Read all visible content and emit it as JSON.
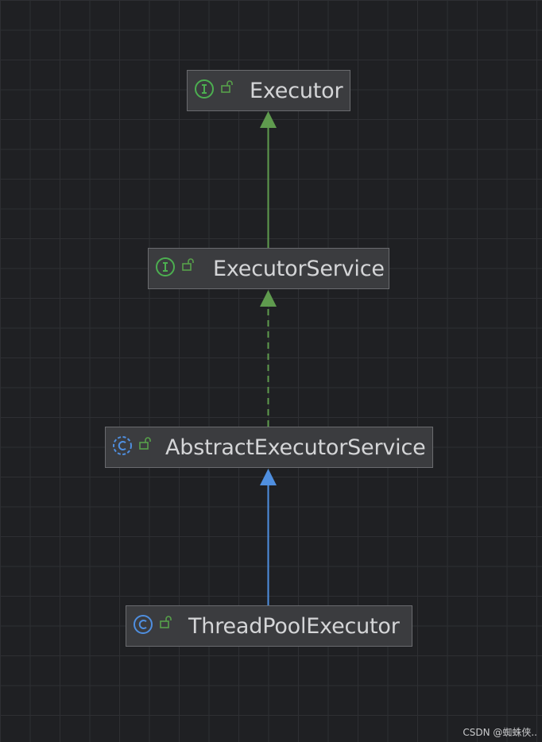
{
  "diagram": {
    "nodes": [
      {
        "id": "executor",
        "label": "Executor",
        "kind": "interface"
      },
      {
        "id": "executor-service",
        "label": "ExecutorService",
        "kind": "interface"
      },
      {
        "id": "abstract-executor-service",
        "label": "AbstractExecutorService",
        "kind": "abstract-class"
      },
      {
        "id": "thread-pool-executor",
        "label": "ThreadPoolExecutor",
        "kind": "class"
      }
    ],
    "edges": [
      {
        "from": "executor-service",
        "to": "executor",
        "relation": "extends",
        "style": "solid",
        "color": "#5f9b4e"
      },
      {
        "from": "abstract-executor-service",
        "to": "executor-service",
        "relation": "implements",
        "style": "dashed",
        "color": "#5f9b4e"
      },
      {
        "from": "thread-pool-executor",
        "to": "abstract-executor-service",
        "relation": "extends",
        "style": "solid",
        "color": "#4f8fe0"
      }
    ],
    "icons": {
      "interface": "interface-icon",
      "abstract-class": "abstract-class-icon",
      "class": "class-icon",
      "visibility": "public-lock-icon"
    },
    "colors": {
      "interface": "#4caf50",
      "class": "#4f8fe0",
      "lock": "#57a04a"
    }
  },
  "watermark": "CSDN @蜘蛛侠.."
}
